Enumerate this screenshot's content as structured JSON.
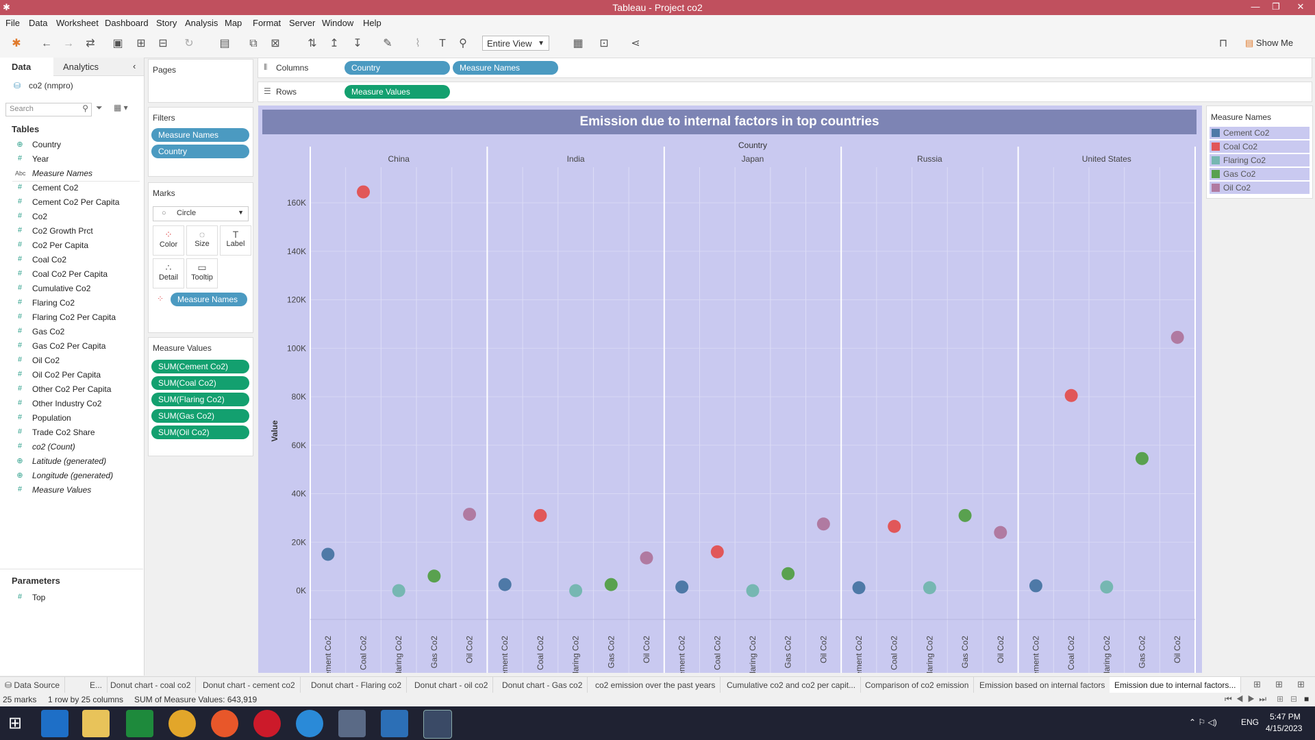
{
  "window": {
    "title": "Tableau - Project co2"
  },
  "menu": [
    "File",
    "Data",
    "Worksheet",
    "Dashboard",
    "Story",
    "Analysis",
    "Map",
    "Format",
    "Server",
    "Window",
    "Help"
  ],
  "toolbar": {
    "view_select": "Entire View",
    "show_me": "Show Me"
  },
  "data_pane": {
    "tab_data": "Data",
    "tab_analytics": "Analytics",
    "datasource": "co2 (nmpro)",
    "search_placeholder": "Search",
    "tables_header": "Tables",
    "fields": [
      {
        "label": "Country",
        "icon": "globe-icon",
        "italic": false
      },
      {
        "label": "Year",
        "icon": "hash-icon",
        "italic": false
      },
      {
        "label": "Measure Names",
        "icon": "abc-icon",
        "italic": true
      },
      {
        "label": "Cement Co2",
        "icon": "hash-icon",
        "italic": false
      },
      {
        "label": "Cement Co2 Per Capita",
        "icon": "hash-icon",
        "italic": false
      },
      {
        "label": "Co2",
        "icon": "hash-icon",
        "italic": false
      },
      {
        "label": "Co2 Growth Prct",
        "icon": "hash-icon",
        "italic": false
      },
      {
        "label": "Co2 Per Capita",
        "icon": "hash-icon",
        "italic": false
      },
      {
        "label": "Coal Co2",
        "icon": "hash-icon",
        "italic": false
      },
      {
        "label": "Coal Co2 Per Capita",
        "icon": "hash-icon",
        "italic": false
      },
      {
        "label": "Cumulative Co2",
        "icon": "hash-icon",
        "italic": false
      },
      {
        "label": "Flaring Co2",
        "icon": "hash-icon",
        "italic": false
      },
      {
        "label": "Flaring Co2 Per Capita",
        "icon": "hash-icon",
        "italic": false
      },
      {
        "label": "Gas Co2",
        "icon": "hash-icon",
        "italic": false
      },
      {
        "label": "Gas Co2 Per Capita",
        "icon": "hash-icon",
        "italic": false
      },
      {
        "label": "Oil Co2",
        "icon": "hash-icon",
        "italic": false
      },
      {
        "label": "Oil Co2 Per Capita",
        "icon": "hash-icon",
        "italic": false
      },
      {
        "label": "Other Co2 Per Capita",
        "icon": "hash-icon",
        "italic": false
      },
      {
        "label": "Other Industry Co2",
        "icon": "hash-icon",
        "italic": false
      },
      {
        "label": "Population",
        "icon": "hash-icon",
        "italic": false
      },
      {
        "label": "Trade Co2 Share",
        "icon": "hash-icon",
        "italic": false
      },
      {
        "label": "co2 (Count)",
        "icon": "hash-icon",
        "italic": true
      },
      {
        "label": "Latitude (generated)",
        "icon": "globe-icon",
        "italic": true
      },
      {
        "label": "Longitude (generated)",
        "icon": "globe-icon",
        "italic": true
      },
      {
        "label": "Measure Values",
        "icon": "hash-icon",
        "italic": true
      }
    ],
    "parameters_header": "Parameters",
    "parameters": [
      {
        "label": "Top",
        "icon": "hash-icon"
      }
    ]
  },
  "pages_card": {
    "header": "Pages"
  },
  "filters_card": {
    "header": "Filters",
    "pills": [
      "Measure Names",
      "Country"
    ]
  },
  "marks_card": {
    "header": "Marks",
    "mark_type": "Circle",
    "buttons": [
      "Color",
      "Size",
      "Label",
      "Detail",
      "Tooltip"
    ],
    "color_pill": "Measure Names"
  },
  "measure_values_card": {
    "header": "Measure Values",
    "pills": [
      "SUM(Cement Co2)",
      "SUM(Coal Co2)",
      "SUM(Flaring Co2)",
      "SUM(Gas Co2)",
      "SUM(Oil Co2)"
    ]
  },
  "shelves": {
    "columns_label": "Columns",
    "columns_pills": [
      "Country",
      "Measure Names"
    ],
    "rows_label": "Rows",
    "rows_pills": [
      "Measure Values"
    ]
  },
  "legend": {
    "header": "Measure Names",
    "items": [
      {
        "label": "Cement Co2",
        "color": "#4e79a7"
      },
      {
        "label": "Coal Co2",
        "color": "#e15759"
      },
      {
        "label": "Flaring Co2",
        "color": "#76b7b2"
      },
      {
        "label": "Gas Co2",
        "color": "#59a14f"
      },
      {
        "label": "Oil Co2",
        "color": "#b07aa1"
      }
    ]
  },
  "chart_data": {
    "type": "scatter",
    "title": "Emission due to internal factors in top countries",
    "column_header": "Country",
    "ylabel": "Value",
    "ylim": [
      -10000,
      170000
    ],
    "yticks": [
      0,
      20000,
      40000,
      60000,
      80000,
      100000,
      120000,
      140000,
      160000
    ],
    "ytick_labels": [
      "0K",
      "20K",
      "40K",
      "60K",
      "80K",
      "100K",
      "120K",
      "140K",
      "160K"
    ],
    "countries": [
      "China",
      "India",
      "Japan",
      "Russia",
      "United States"
    ],
    "measures": [
      "Cement Co2",
      "Coal Co2",
      "Flaring Co2",
      "Gas Co2",
      "Oil Co2"
    ],
    "series": [
      {
        "name": "Cement Co2",
        "color": "#4e79a7",
        "values": [
          15000,
          2500,
          1500,
          1200,
          2000
        ]
      },
      {
        "name": "Coal Co2",
        "color": "#e15759",
        "values": [
          164500,
          31000,
          16000,
          26500,
          80500
        ]
      },
      {
        "name": "Flaring Co2",
        "color": "#76b7b2",
        "values": [
          0,
          0,
          0,
          1200,
          1500
        ]
      },
      {
        "name": "Gas Co2",
        "color": "#59a14f",
        "values": [
          6000,
          2500,
          7000,
          31000,
          54500
        ]
      },
      {
        "name": "Oil Co2",
        "color": "#b07aa1",
        "values": [
          31500,
          13500,
          27500,
          24000,
          104500
        ]
      }
    ]
  },
  "sheet_tabs": {
    "data_source": "Data Source",
    "tabs": [
      "E...",
      "Donut chart - coal co2",
      "Donut chart - cement co2",
      "Donut chart - Flaring co2",
      "Donut chart - oil co2",
      "Donut chart - Gas co2",
      "co2 emission over the past years",
      "Cumulative co2 and co2 per capit...",
      "Comparison of co2 emission",
      "Emission based on internal factors",
      "Emission due to internal factors..."
    ],
    "active_index": 10
  },
  "status": {
    "marks": "25 marks",
    "rows": "1 row by 25 columns",
    "sum": "SUM of Measure Values: 643,919"
  },
  "taskbar": {
    "lang": "ENG",
    "time": "5:47 PM",
    "date": "4/15/2023"
  }
}
